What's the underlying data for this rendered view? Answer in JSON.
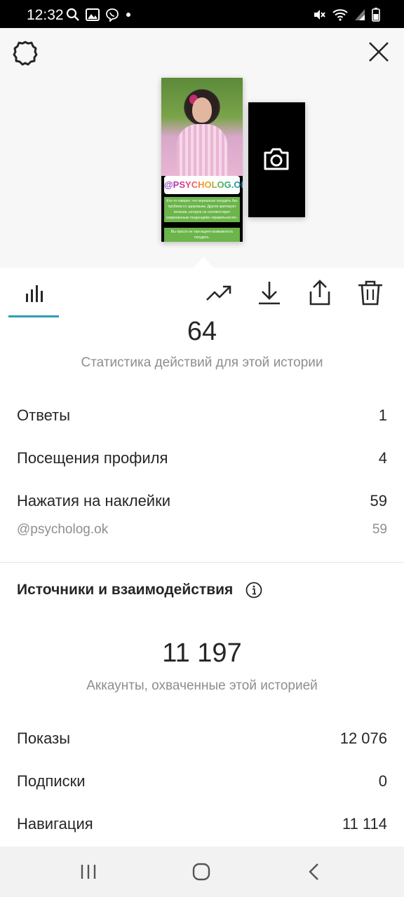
{
  "status_bar": {
    "time": "12:32",
    "left_icons": [
      "search-icon",
      "gallery-icon",
      "viber-icon",
      "dot-icon"
    ],
    "right_icons": [
      "mute-icon",
      "wifi-icon",
      "signal-icon",
      "battery-icon"
    ]
  },
  "preview": {
    "sticker": "@PSYCHOLOG.OK",
    "caption_1": "Кто-то говорит, что нереально похудеть без проблем со здоровьем. Другие критикуют питание, которое не соответствует современным тенденциям «правильности».",
    "caption_2": "Вы просто не там ищите возможность похудеть."
  },
  "toolbar": {
    "icons": [
      "insights-icon",
      "trending-icon",
      "download-icon",
      "share-icon",
      "trash-icon"
    ]
  },
  "actions": {
    "total": "64",
    "subtitle": "Статистика действий для этой истории",
    "rows": [
      {
        "label": "Ответы",
        "value": "1"
      },
      {
        "label": "Посещения профиля",
        "value": "4"
      },
      {
        "label": "Нажатия на наклейки",
        "value": "59"
      }
    ],
    "sticker_row": {
      "label": "@psycholog.ok",
      "value": "59"
    }
  },
  "discovery": {
    "title": "Источники и взаимодействия",
    "total": "11 197",
    "subtitle": "Аккаунты, охваченные этой историей",
    "rows": [
      {
        "label": "Показы",
        "value": "12 076"
      },
      {
        "label": "Подписки",
        "value": "0"
      },
      {
        "label": "Навигация",
        "value": "11 114"
      }
    ]
  },
  "colors": {
    "accent_underline": "#2f9fb6",
    "secondary_text": "#8e8e8e",
    "caption_bg": "#6bb54a"
  }
}
